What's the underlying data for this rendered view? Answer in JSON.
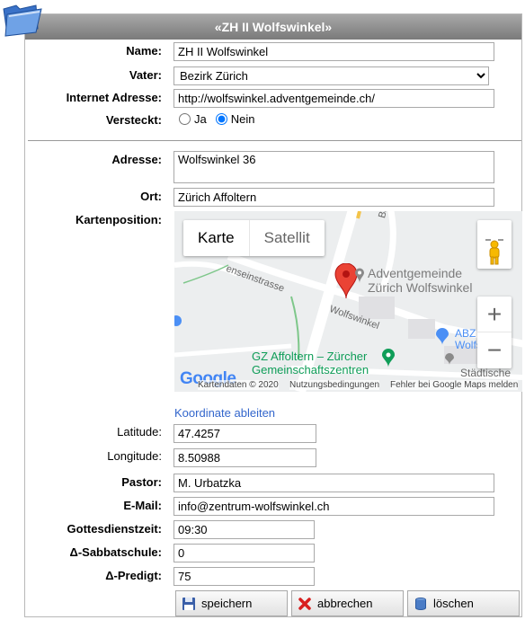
{
  "window": {
    "title": "«ZH II Wolfswinkel»"
  },
  "form": {
    "name_label": "Name:",
    "name_value": "ZH II Wolfswinkel",
    "vater_label": "Vater:",
    "vater_value": "Bezirk Zürich",
    "internet_label": "Internet Adresse:",
    "internet_value": "http://wolfswinkel.adventgemeinde.ch/",
    "versteckt_label": "Versteckt:",
    "versteckt_ja": "Ja",
    "versteckt_nein": "Nein",
    "versteckt_selected": "Nein",
    "adresse_label": "Adresse:",
    "adresse_value": "Wolfswinkel 36",
    "ort_label": "Ort:",
    "ort_value": "Zürich Affoltern",
    "karte_label": "Kartenposition:",
    "koordinate_link": "Koordinate ableiten",
    "latitude_label": "Latitude:",
    "latitude_value": "47.4257",
    "longitude_label": "Longitude:",
    "longitude_value": "8.50988",
    "pastor_label": "Pastor:",
    "pastor_value": "M. Urbatzka",
    "email_label": "E-Mail:",
    "email_value": "info@zentrum-wolfswinkel.ch",
    "gottesdienst_label": "Gottesdienstzeit:",
    "gottesdienst_value": "09:30",
    "sabbatschule_label": "Δ-Sabbatschule:",
    "sabbatschule_value": "0",
    "predigt_label": "Δ-Predigt:",
    "predigt_value": "75"
  },
  "map": {
    "type_karte": "Karte",
    "type_satellit": "Satellit",
    "marker_title": "Adventgemeinde",
    "marker_subtitle": "Zürich Wolfswinkel",
    "street_1": "Bärenbohlstr.",
    "street_2": "enseinstrasse",
    "street_3": "Wolfswinkel",
    "poi_gz_1": "GZ Affoltern – Zürcher",
    "poi_gz_2": "Gemeinschaftszentren",
    "poi_abz_1": "ABZ",
    "poi_abz_2": "Wolfs",
    "poi_staedt": "Städtische",
    "google_logo": "Google",
    "attrib_data": "Kartendaten © 2020",
    "attrib_terms": "Nutzungsbedingungen",
    "attrib_error": "Fehler bei Google Maps melden",
    "zoom_in": "+",
    "zoom_out": "−"
  },
  "buttons": {
    "save": "speichern",
    "cancel": "abbrechen",
    "delete": "löschen"
  },
  "colors": {
    "title_bar": "#8c8c8c",
    "link": "#3366cc",
    "marker": "#ea4335",
    "poi_green": "#0f9d58"
  }
}
